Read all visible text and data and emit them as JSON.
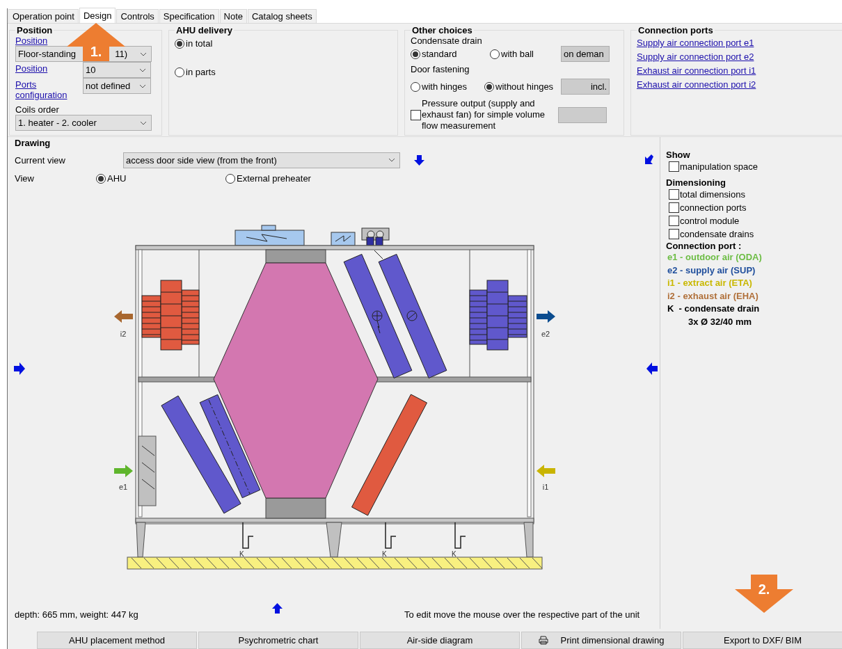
{
  "tabs": [
    {
      "label": "Operation point",
      "selected": false
    },
    {
      "label": "Design",
      "selected": true
    },
    {
      "label": "Controls",
      "selected": false
    },
    {
      "label": "Specification",
      "selected": false
    },
    {
      "label": "Note",
      "selected": false
    },
    {
      "label": "Catalog sheets",
      "selected": false
    }
  ],
  "position": {
    "title": "Position",
    "link": "Position",
    "mounting": "Floor-standing",
    "mounting_tail": "11)",
    "rows": [
      {
        "label": "Position",
        "value": "10"
      },
      {
        "label": "Ports configuration",
        "value": "not defined"
      }
    ],
    "coils_label": "Coils order",
    "coils": "1. heater - 2. cooler"
  },
  "ahu_delivery": {
    "title": "AHU delivery",
    "options": [
      {
        "label": "in total",
        "selected": true
      },
      {
        "label": "in parts",
        "selected": false
      }
    ]
  },
  "other_choices": {
    "title": "Other choices",
    "condensate": {
      "label": "Condensate drain",
      "options": [
        {
          "label": "standard",
          "selected": true
        },
        {
          "label": "with ball",
          "selected": false
        }
      ],
      "button": "on deman"
    },
    "door": {
      "label": "Door fastening",
      "options": [
        {
          "label": "with hinges",
          "selected": false
        },
        {
          "label": "without hinges",
          "selected": true
        }
      ],
      "button": "incl."
    },
    "pressure": {
      "label": "Pressure output (supply and exhaust fan) for simple volume flow measurement",
      "checked": false
    }
  },
  "connection_ports": {
    "title": "Connection ports",
    "links": [
      "Supply air connection port e1",
      "Supply air connection port e2",
      "Exhaust air connection port i1",
      "Exhaust air connection port i2"
    ]
  },
  "drawing": {
    "title": "Drawing",
    "current_view": {
      "label": "Current view",
      "value": "access door side view (from the front)"
    },
    "view": {
      "label": "View",
      "options": [
        {
          "label": "AHU",
          "selected": true
        },
        {
          "label": "External preheater",
          "selected": false
        }
      ]
    },
    "ports": [
      {
        "label": "i2",
        "kind": "outlet",
        "color": "#a8672f"
      },
      {
        "label": "e2",
        "kind": "outlet",
        "color": "#0b4c8f"
      },
      {
        "label": "e1",
        "kind": "inlet",
        "color": "#5fb52c"
      },
      {
        "label": "i1",
        "kind": "inlet",
        "color": "#c9b400"
      }
    ],
    "drains": [
      "K",
      "K",
      "K"
    ],
    "footer": "depth: 665 mm, weight: 447 kg",
    "hint": "To edit move the mouse over the respective part of the unit"
  },
  "side": {
    "show": {
      "title": "Show",
      "options": [
        {
          "label": "manipulation space",
          "checked": false
        }
      ]
    },
    "dimensioning": {
      "title": "Dimensioning",
      "options": [
        {
          "label": "total dimensions",
          "checked": false
        },
        {
          "label": "connection ports",
          "checked": false
        },
        {
          "label": "control module",
          "checked": false
        },
        {
          "label": "condensate drains",
          "checked": false
        }
      ]
    },
    "legend": {
      "title": "Connection port :",
      "items": [
        {
          "label": "e1 - outdoor air (ODA)",
          "color": "#6dbd45"
        },
        {
          "label": "e2 - supply air (SUP)",
          "color": "#1f4e9c"
        },
        {
          "label": "i1 - extract air (ETA)",
          "color": "#c9b800"
        },
        {
          "label": "i2 - exhaust air (EHA)",
          "color": "#b0703a"
        },
        {
          "label": "K  - condensate drain",
          "color": "#000000"
        }
      ],
      "note": "3x Ø 32/40 mm"
    }
  },
  "buttons": [
    {
      "label": "AHU placement method",
      "kind": "plain"
    },
    {
      "label": "Psychrometric chart",
      "kind": "plain"
    },
    {
      "label": "Air-side diagram",
      "kind": "plain"
    },
    {
      "label": "Print dimensional drawing",
      "kind": "print"
    },
    {
      "label": "Export to DXF/ BIM",
      "kind": "plain"
    }
  ],
  "callouts": [
    {
      "label": "1.",
      "kind": "up"
    },
    {
      "label": "2.",
      "kind": "down"
    }
  ]
}
